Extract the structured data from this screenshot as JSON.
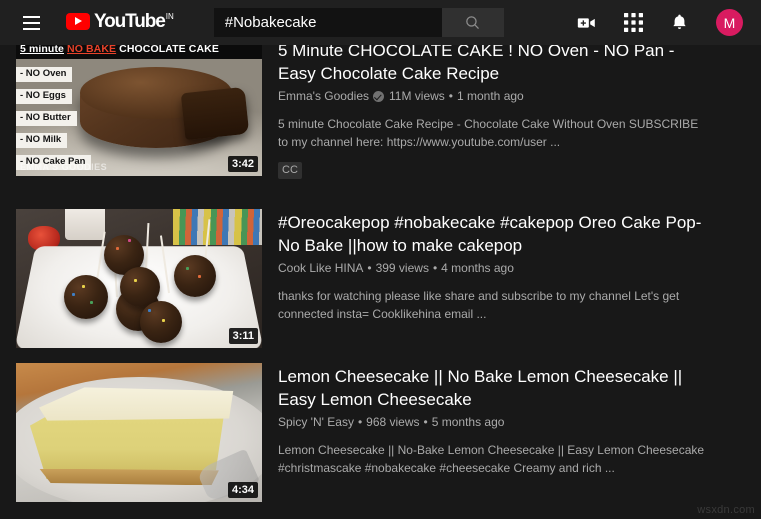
{
  "header": {
    "menu_icon": "hamburger-menu-icon",
    "logo_text": "YouTube",
    "logo_country_code": "IN",
    "search": {
      "value": "#Nobakecake",
      "placeholder": "Search",
      "button_icon": "search-icon"
    },
    "icons": [
      {
        "name": "create-video-icon",
        "label": "Create"
      },
      {
        "name": "apps-grid-icon",
        "label": "YouTube apps"
      },
      {
        "name": "notifications-bell-icon",
        "label": "Notifications"
      }
    ],
    "avatar_initial": "M",
    "avatar_color": "#d81b60"
  },
  "results": [
    {
      "title": "5 Minute CHOCOLATE CAKE ! NO Oven - NO Pan - Easy Chocolate Cake Recipe",
      "channel": "Emma's Goodies",
      "verified": true,
      "views": "11M views",
      "age": "1 month ago",
      "description": "5 minute Chocolate Cake Recipe - Chocolate Cake Without Oven SUBSCRIBE to my channel here: https://www.youtube.com/user ...",
      "duration": "3:42",
      "badges": [
        "CC"
      ],
      "thumbnail": {
        "kind": "chocolate-cake",
        "header_prefix": "5 minute",
        "header_highlight": "NO BAKE",
        "header_suffix": "CHOCOLATE CAKE",
        "highlight_color": "#e8422a",
        "bullets": [
          "- NO Oven",
          "- NO Eggs",
          "- NO Butter",
          "- NO Milk",
          "- NO Cake Pan"
        ],
        "watermark": "EMMA'S GOODIES"
      }
    },
    {
      "title": "#Oreocakepop #nobakecake #cakepop Oreo Cake Pop- No Bake ||how to make cakepop",
      "channel": "Cook Like HINA",
      "verified": false,
      "views": "399 views",
      "age": "4 months ago",
      "description": "thanks for watching please like share and subscribe to my channel Let's get connected insta= Cooklikehina email ...",
      "duration": "3:11",
      "badges": [],
      "thumbnail": {
        "kind": "cake-pops"
      }
    },
    {
      "title": "Lemon Cheesecake || No Bake Lemon Cheesecake || Easy Lemon Cheesecake",
      "channel": "Spicy 'N' Easy",
      "verified": false,
      "views": "968 views",
      "age": "5 months ago",
      "description": "Lemon Cheesecake || No-Bake Lemon Cheesecake || Easy Lemon Cheesecake #christmascake #nobakecake #cheesecake Creamy and rich ...",
      "duration": "4:34",
      "badges": [],
      "thumbnail": {
        "kind": "lemon-cheesecake"
      }
    }
  ],
  "separator": "•",
  "watermark": "wsxdn.com"
}
